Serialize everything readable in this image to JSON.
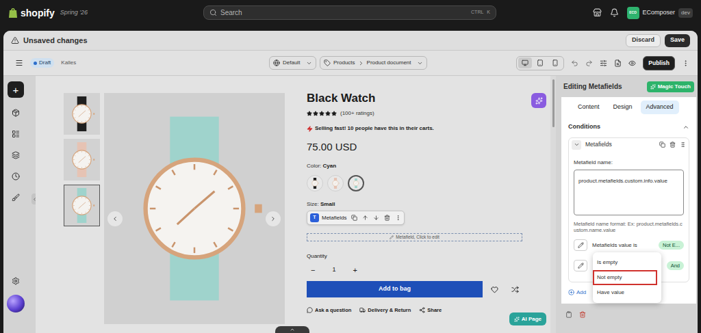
{
  "topbar": {
    "brand": "shopify",
    "edition": "Spring '26",
    "search": {
      "placeholder": "Search",
      "shortcut": [
        "CTRL",
        "K"
      ]
    },
    "store": {
      "initials": "ECO",
      "name": "EComposer",
      "badge": "dev"
    }
  },
  "header": {
    "title": "Unsaved changes",
    "buttons": [
      {
        "label": "Discard",
        "primary": false
      },
      {
        "label": "Save",
        "primary": true
      }
    ]
  },
  "toolbar": {
    "status": "Draft",
    "theme": "Kalles",
    "language": "Default",
    "breadcrumb": [
      "Products",
      "Product document"
    ],
    "devices": [
      {
        "selected": true
      },
      {
        "selected": false
      },
      {
        "selected": false
      }
    ],
    "publish": "Publish"
  },
  "sidebar": {
    "add": "+"
  },
  "product": {
    "title": "Black Watch",
    "stars": 5,
    "rating": "(100+ ratings)",
    "urgency": "Selling fast! 10 people have this in their carts.",
    "price": "75.00 USD",
    "color": {
      "label": "Color:",
      "value": "Cyan"
    },
    "swatches": [
      {
        "color": "#1f1f1f",
        "selected": false
      },
      {
        "color": "#e6c3b4",
        "selected": false
      },
      {
        "color": "#9fd3cc",
        "selected": true
      }
    ],
    "size": {
      "label": "Size:",
      "value": "Small"
    },
    "thumbnails": [
      {
        "color": "#1f1f1f",
        "selected": false
      },
      {
        "color": "#e6c3b4",
        "selected": false
      },
      {
        "color": "#9fd3cc",
        "selected": true
      }
    ],
    "quantity": {
      "label": "Quantity",
      "value": "1",
      "decrement": "−",
      "increment": "+"
    },
    "add_to_bag": "Add to bag",
    "links": [
      "Ask a question",
      "Delivery & Return",
      "Share"
    ]
  },
  "element_toolbar": {
    "badge": "T",
    "label": "Metafields"
  },
  "placeholder": "Metafield, Click to edit",
  "ai_button": "AI Page",
  "panel": {
    "title": "Editing Metafields",
    "magic": "Magic Touch",
    "tabs": [
      {
        "label": "Content",
        "selected": false
      },
      {
        "label": "Design",
        "selected": false
      },
      {
        "label": "Advanced",
        "selected": true
      }
    ],
    "section": {
      "title": "Conditions",
      "expanded": true
    },
    "condition": {
      "title": "Metafields",
      "expanded": true,
      "name_label": "Metafield name:",
      "name_value": "product.metafields.custom.info.value",
      "hint": "Metafield name format: Ex: product.metafields.custom.name.value",
      "rows": [
        {
          "label": "Metafields value is",
          "badge": "Not E..."
        },
        {
          "label": "",
          "badge": "And"
        }
      ]
    },
    "add": "Add"
  },
  "menu": {
    "items": [
      {
        "label": "Is empty",
        "selected": false
      },
      {
        "label": "Not empty",
        "selected": true
      },
      {
        "label": "Have value",
        "selected": false
      }
    ]
  }
}
